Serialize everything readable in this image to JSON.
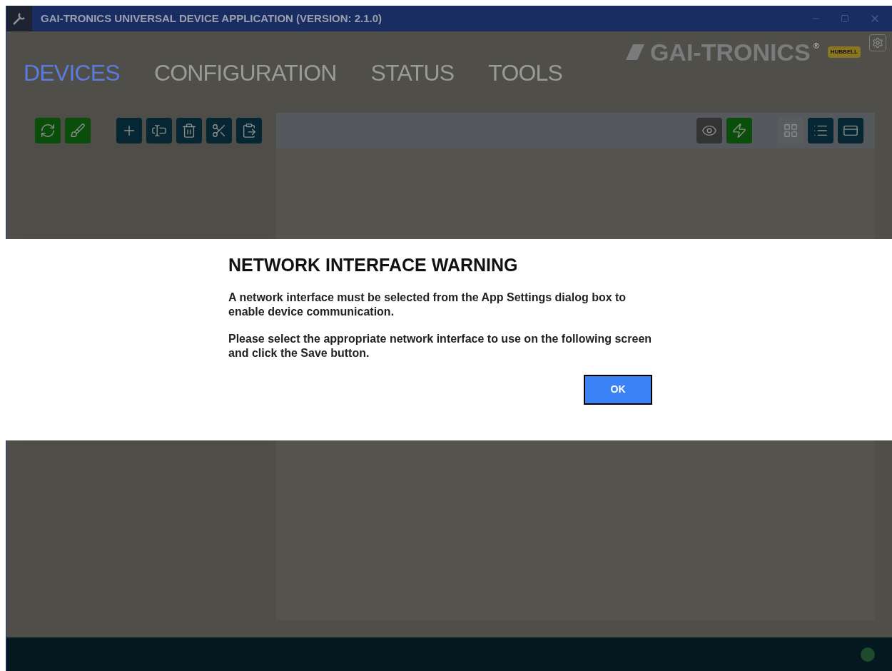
{
  "window": {
    "title": "GAI-TRONICS UNIVERSAL DEVICE APPLICATION (VERSION: 2.1.0)"
  },
  "logo": {
    "name": "GAI-TRONICS",
    "mark": "®",
    "badge": "HUBBELL"
  },
  "tabs": [
    {
      "label": "DEVICES",
      "selected": true
    },
    {
      "label": "CONFIGURATION",
      "selected": false
    },
    {
      "label": "STATUS",
      "selected": false
    },
    {
      "label": "TOOLS",
      "selected": false
    }
  ],
  "left_toolbar": [
    {
      "color": "#0b4d0b"
    },
    {
      "color": "#0b4d0b"
    },
    {
      "color": "#062634"
    },
    {
      "color": "#062634"
    },
    {
      "color": "#062634"
    },
    {
      "color": "#062634"
    },
    {
      "color": "#062634"
    }
  ],
  "right_toolbar": [
    {
      "color": "#333333"
    },
    {
      "color": "#0b4d0b"
    },
    {
      "color": "#5a5d60"
    },
    {
      "color": "#062634"
    },
    {
      "color": "#062634"
    }
  ],
  "dialog": {
    "title": "NETWORK INTERFACE WARNING",
    "paragraphs": [
      "A network interface must be selected from the App Settings dialog box to enable device communication.",
      "Please select the appropriate network interface to use on the following screen and click the Save button."
    ],
    "button": "OK"
  }
}
